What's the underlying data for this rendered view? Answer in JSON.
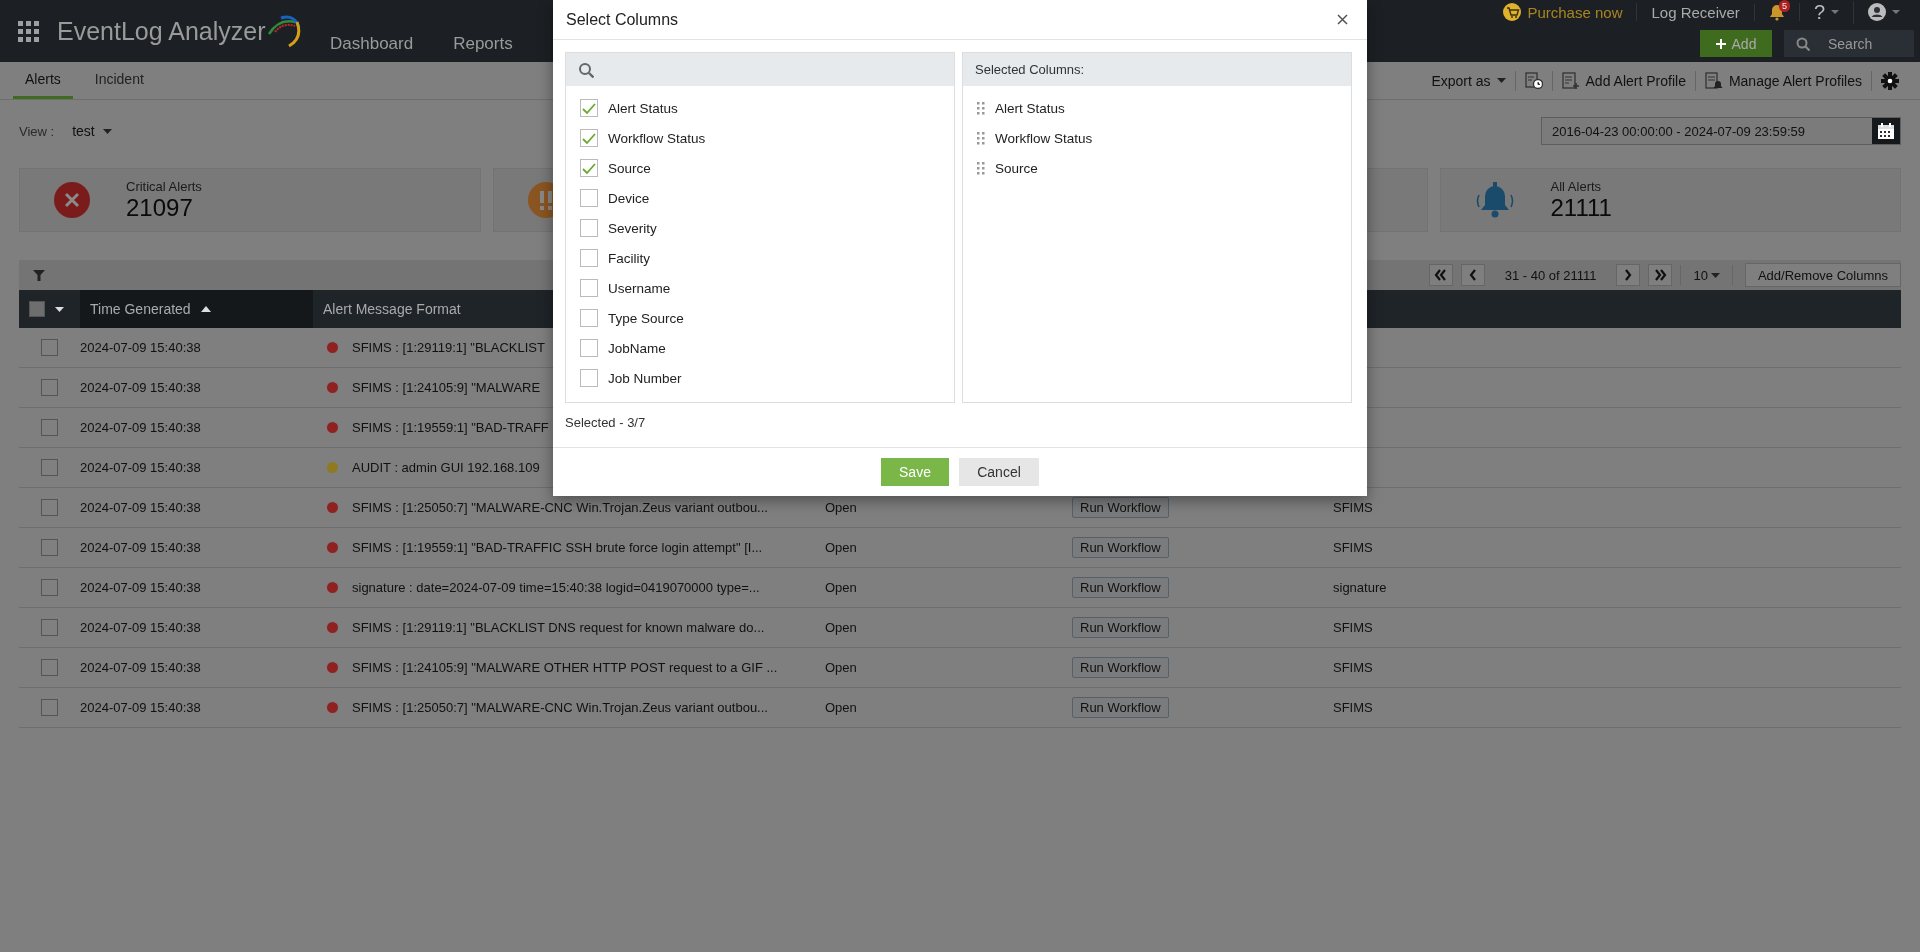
{
  "header": {
    "app_name": "EventLog Analyzer",
    "nav": [
      "Dashboard",
      "Reports"
    ],
    "purchase": "Purchase now",
    "log_receiver": "Log Receiver",
    "notification_count": "5",
    "help": "?",
    "add_button": "Add",
    "search_placeholder": "Search"
  },
  "tabs": [
    {
      "label": "Alerts",
      "selected": true
    },
    {
      "label": "Incident",
      "selected": false
    }
  ],
  "toolbar": {
    "export": "Export as",
    "add_profile": "Add Alert Profile",
    "manage_profiles": "Manage Alert Profiles"
  },
  "view": {
    "label": "View :",
    "value": "test"
  },
  "date_range": "2016-04-23 00:00:00 - 2024-07-09 23:59:59",
  "stat_cards": [
    {
      "kind": "critical",
      "label": "Critical Alerts",
      "count": "21097"
    },
    {
      "kind": "trouble"
    },
    {
      "kind": "plain"
    },
    {
      "kind": "all",
      "label": "All Alerts",
      "count": "21111"
    }
  ],
  "pagination": {
    "range": "31 - 40 of 21111",
    "page_size": "10",
    "columns_button": "Add/Remove Columns"
  },
  "table": {
    "select_all_checked": false,
    "columns": [
      "Time Generated",
      "Alert Message Format"
    ],
    "rows": [
      {
        "checked": false,
        "time": "2024-07-09 15:40:38",
        "color": "#8f2121",
        "message": "SFIMS : [1:29119:1] \"BLACKLIST"
      },
      {
        "checked": false,
        "time": "2024-07-09 15:40:38",
        "color": "#8f2121",
        "message": "SFIMS : [1:24105:9] \"MALWARE"
      },
      {
        "checked": false,
        "time": "2024-07-09 15:40:38",
        "color": "#8f2121",
        "message": "SFIMS : [1:19559:1] \"BAD-TRAFF"
      },
      {
        "checked": false,
        "time": "2024-07-09 15:40:38",
        "color": "#8f7a22",
        "message": "AUDIT : admin GUI 192.168.109"
      },
      {
        "checked": false,
        "time": "2024-07-09 15:40:38",
        "color": "#8f2121",
        "message": "SFIMS : [1:25050:7] \"MALWARE-CNC Win.Trojan.Zeus variant outbou...",
        "status": "Open",
        "action": "Run Workflow",
        "source": "SFIMS"
      },
      {
        "checked": false,
        "time": "2024-07-09 15:40:38",
        "color": "#8f2121",
        "message": "SFIMS : [1:19559:1] \"BAD-TRAFFIC SSH brute force login attempt\" [I...",
        "status": "Open",
        "action": "Run Workflow",
        "source": "SFIMS"
      },
      {
        "checked": false,
        "time": "2024-07-09 15:40:38",
        "color": "#8f2121",
        "message": "signature : date=2024-07-09 time=15:40:38 logid=0419070000 type=...",
        "status": "Open",
        "action": "Run Workflow",
        "source": "signature"
      },
      {
        "checked": false,
        "time": "2024-07-09 15:40:38",
        "color": "#8f2121",
        "message": "SFIMS : [1:29119:1] \"BLACKLIST DNS request for known malware do...",
        "status": "Open",
        "action": "Run Workflow",
        "source": "SFIMS"
      },
      {
        "checked": false,
        "time": "2024-07-09 15:40:38",
        "color": "#8f2121",
        "message": "SFIMS : [1:24105:9] \"MALWARE OTHER HTTP POST request to a GIF ...",
        "status": "Open",
        "action": "Run Workflow",
        "source": "SFIMS"
      },
      {
        "checked": false,
        "time": "2024-07-09 15:40:38",
        "color": "#8f2121",
        "message": "SFIMS : [1:25050:7] \"MALWARE-CNC Win.Trojan.Zeus variant outbou...",
        "status": "Open",
        "action": "Run Workflow",
        "source": "SFIMS"
      }
    ]
  },
  "dialog": {
    "title": "Select Columns",
    "available": [
      {
        "label": "Alert Status",
        "checked": true
      },
      {
        "label": "Workflow Status",
        "checked": true
      },
      {
        "label": "Source",
        "checked": true
      },
      {
        "label": "Device",
        "checked": false
      },
      {
        "label": "Severity",
        "checked": false
      },
      {
        "label": "Facility",
        "checked": false
      },
      {
        "label": "Username",
        "checked": false
      },
      {
        "label": "Type Source",
        "checked": false
      },
      {
        "label": "JobName",
        "checked": false
      },
      {
        "label": "Job Number",
        "checked": false
      }
    ],
    "selected_heading": "Selected Columns:",
    "selected": [
      "Alert Status",
      "Workflow Status",
      "Source"
    ],
    "summary": "Selected - 3/7",
    "save": "Save",
    "cancel": "Cancel"
  }
}
